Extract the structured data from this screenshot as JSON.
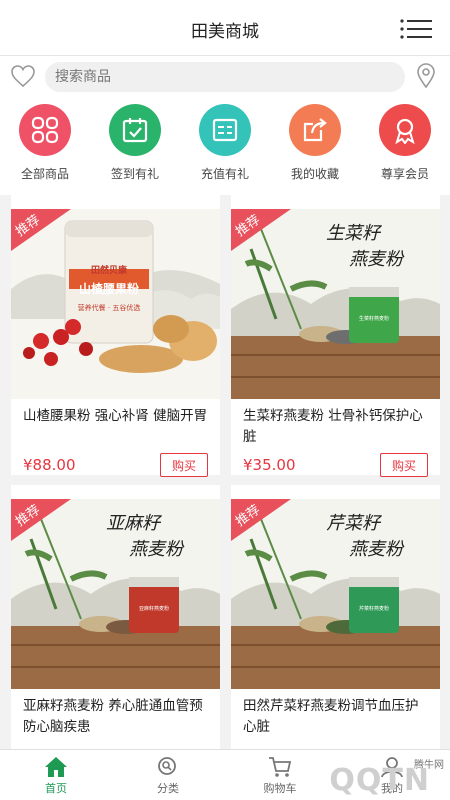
{
  "header": {
    "title": "田美商城",
    "menu_icon": "hamburger-menu-icon"
  },
  "search": {
    "placeholder": "搜索商品",
    "favorite_icon": "heart-outline-icon",
    "location_icon": "location-pin-icon"
  },
  "quick_icons": [
    {
      "label": "全部商品",
      "icon": "grid-icon",
      "color": "#ef5166"
    },
    {
      "label": "签到有礼",
      "icon": "calendar-check-icon",
      "color": "#2ab36a"
    },
    {
      "label": "充值有礼",
      "icon": "clipboard-icon",
      "color": "#33c3b8"
    },
    {
      "label": "我的收藏",
      "icon": "share-icon",
      "color": "#f47c54"
    },
    {
      "label": "尊享会员",
      "icon": "badge-icon",
      "color": "#ee4c4c"
    }
  ],
  "products": [
    {
      "badge": "推荐",
      "name": "山楂腰果粉 强心补肾 健脑开胃",
      "price": "¥88.00",
      "buy_label": "购买",
      "can_brand": "田然贝康",
      "can_title": "山楂腰果粉",
      "can_sub": "营养代餐 · 五谷优选",
      "banner_line1": "",
      "banner_line2": ""
    },
    {
      "badge": "推荐",
      "name": "生菜籽燕麦粉 壮骨补钙保护心脏",
      "price": "¥35.00",
      "buy_label": "购买",
      "can_brand": "",
      "can_title": "生菜籽燕麦粉",
      "can_sub": "",
      "banner_line1": "生菜籽",
      "banner_line2": "燕麦粉"
    },
    {
      "badge": "推荐",
      "name": "亚麻籽燕麦粉 养心脏通血管预防心脑疾患",
      "price": "",
      "buy_label": "",
      "can_brand": "",
      "can_title": "亚麻籽燕麦粉",
      "can_sub": "",
      "banner_line1": "亚麻籽",
      "banner_line2": "燕麦粉"
    },
    {
      "badge": "推荐",
      "name": "田然芹菜籽燕麦粉调节血压护心脏",
      "price": "",
      "buy_label": "",
      "can_brand": "",
      "can_title": "芹菜籽燕麦粉",
      "can_sub": "",
      "banner_line1": "芹菜籽",
      "banner_line2": "燕麦粉"
    }
  ],
  "tabbar": {
    "items": [
      {
        "label": "首页",
        "icon": "home-icon",
        "active": true
      },
      {
        "label": "分类",
        "icon": "category-search-icon",
        "active": false
      },
      {
        "label": "购物车",
        "icon": "cart-icon",
        "active": false
      },
      {
        "label": "我的",
        "icon": "user-icon",
        "active": false
      }
    ],
    "watermark": "腾牛网",
    "watermark_logo": "QQTN"
  },
  "colors": {
    "accent_green": "#1e9a52",
    "price_red": "#e7353f",
    "badge_red": "#e8505b"
  }
}
